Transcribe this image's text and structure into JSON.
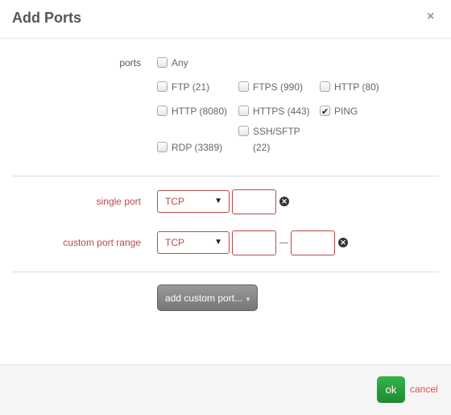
{
  "dialog": {
    "title": "Add Ports",
    "close": "×"
  },
  "ports": {
    "label": "ports",
    "options": [
      {
        "label": "Any",
        "checked": false
      },
      {
        "label": "FTP (21)",
        "checked": false
      },
      {
        "label": "FTPS (990)",
        "checked": false
      },
      {
        "label": "HTTP (80)",
        "checked": false
      },
      {
        "label": "HTTP (8080)",
        "checked": false
      },
      {
        "label": "HTTPS (443)",
        "checked": false
      },
      {
        "label": "PING",
        "checked": true
      },
      {
        "label": "SSH/SFTP (22)",
        "checked": false
      },
      {
        "label": "RDP (3389)",
        "checked": false
      }
    ]
  },
  "single_port": {
    "label": "single port",
    "protocol": "TCP",
    "value": ""
  },
  "custom_range": {
    "label": "custom port range",
    "protocol": "TCP",
    "from": "",
    "to": ""
  },
  "add_custom": {
    "label": "add custom port..."
  },
  "footer": {
    "ok": "ok",
    "cancel": "cancel"
  },
  "colors": {
    "error": "#b94a48",
    "ok": "#28a23d",
    "cancel": "#d9534f"
  }
}
